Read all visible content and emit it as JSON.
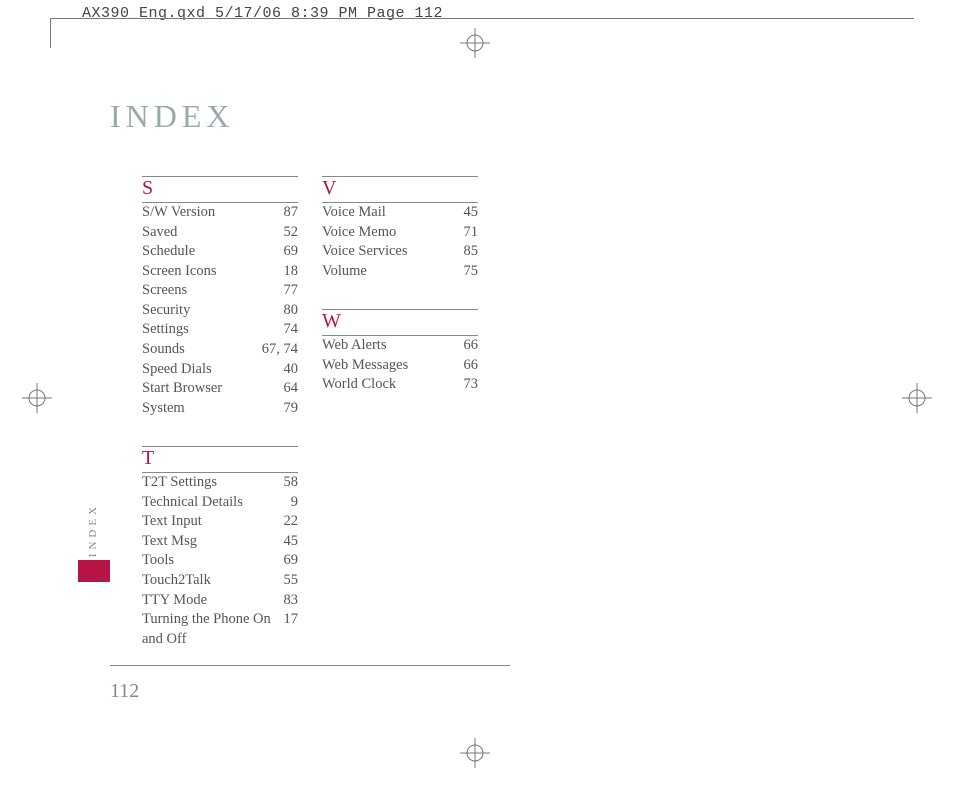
{
  "crop_header": "AX390_Eng.qxd  5/17/06  8:39 PM  Page 112",
  "title": "INDEX",
  "side_label": "INDEX",
  "page_number": "112",
  "sections": {
    "S": {
      "letter": "S",
      "entries": [
        {
          "term": "S/W Version",
          "page": "87"
        },
        {
          "term": "Saved",
          "page": "52"
        },
        {
          "term": "Schedule",
          "page": "69"
        },
        {
          "term": "Screen Icons",
          "page": "18"
        },
        {
          "term": "Screens",
          "page": "77"
        },
        {
          "term": "Security",
          "page": "80"
        },
        {
          "term": "Settings",
          "page": "74"
        },
        {
          "term": "Sounds",
          "page": "67, 74"
        },
        {
          "term": "Speed Dials",
          "page": "40"
        },
        {
          "term": "Start Browser",
          "page": "64"
        },
        {
          "term": "System",
          "page": "79"
        }
      ]
    },
    "T": {
      "letter": "T",
      "entries": [
        {
          "term": "T2T Settings",
          "page": "58"
        },
        {
          "term": "Technical Details",
          "page": "9"
        },
        {
          "term": "Text Input",
          "page": "22"
        },
        {
          "term": "Text Msg",
          "page": "45"
        },
        {
          "term": "Tools",
          "page": "69"
        },
        {
          "term": "Touch2Talk",
          "page": "55"
        },
        {
          "term": "TTY Mode",
          "page": "83"
        },
        {
          "term": "Turning the Phone On and Off",
          "page": "17"
        }
      ]
    },
    "V": {
      "letter": "V",
      "entries": [
        {
          "term": "Voice Mail",
          "page": "45"
        },
        {
          "term": "Voice Memo",
          "page": "71"
        },
        {
          "term": "Voice Services",
          "page": "85"
        },
        {
          "term": "Volume",
          "page": "75"
        }
      ]
    },
    "W": {
      "letter": "W",
      "entries": [
        {
          "term": "Web Alerts",
          "page": "66"
        },
        {
          "term": "Web Messages",
          "page": "66"
        },
        {
          "term": "World Clock",
          "page": "73"
        }
      ]
    }
  }
}
